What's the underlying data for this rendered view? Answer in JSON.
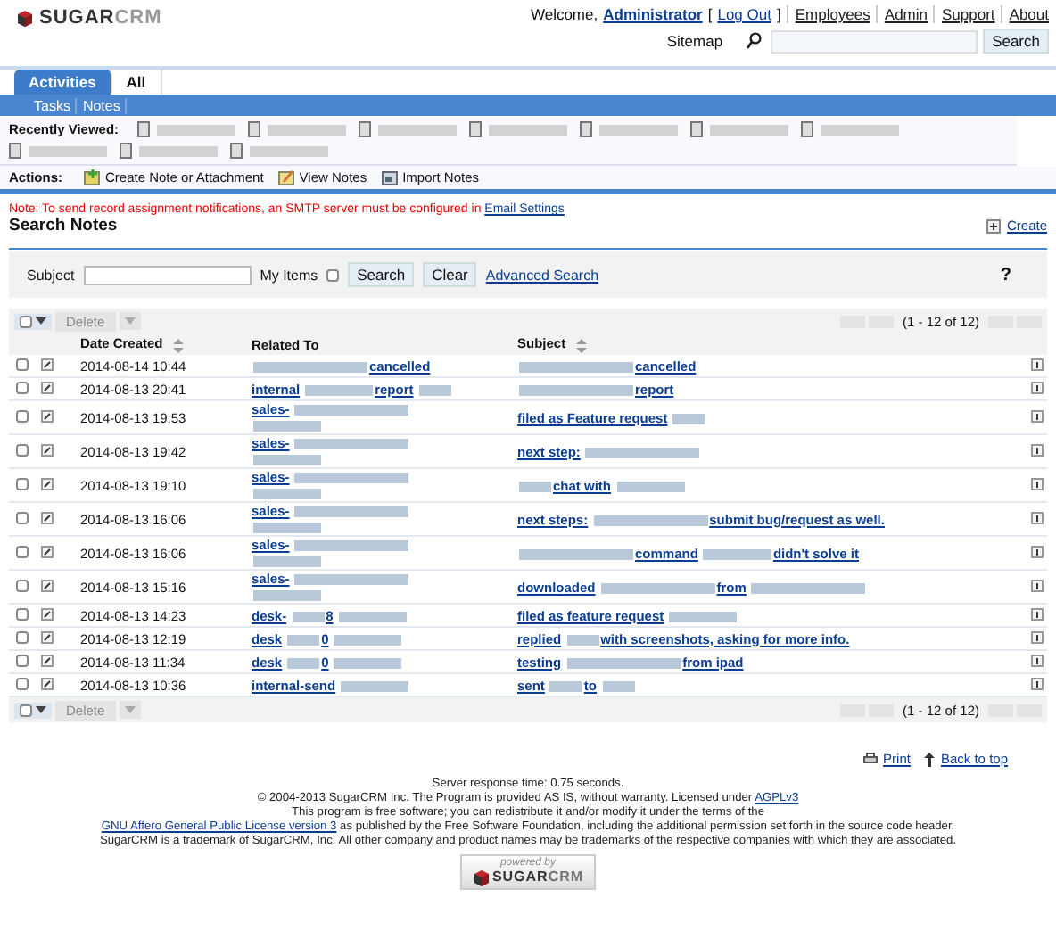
{
  "header": {
    "logo_main": "SUGAR",
    "logo_tail": "CRM",
    "welcome": "Welcome,",
    "user": "Administrator",
    "logout_open": "[",
    "logout": "Log Out",
    "logout_close": "]",
    "links": [
      "Employees",
      "Admin",
      "Support",
      "About"
    ],
    "sitemap": "Sitemap",
    "search_button": "Search"
  },
  "tabs": [
    {
      "label": "Activities",
      "selected": true
    },
    {
      "label": "All",
      "selected": false
    }
  ],
  "subtabs": [
    {
      "label": "Tasks"
    },
    {
      "label": "Notes"
    }
  ],
  "recently_viewed": {
    "label": "Recently Viewed:",
    "items": [
      {
        "kind": "blurred"
      },
      {
        "kind": "blurred"
      },
      {
        "kind": "blurred"
      },
      {
        "kind": "blurred"
      },
      {
        "kind": "blurred"
      },
      {
        "kind": "blurred"
      },
      {
        "kind": "blurred"
      },
      {
        "kind": "blurred"
      },
      {
        "kind": "blurred"
      },
      {
        "kind": "blurred"
      }
    ]
  },
  "actions": {
    "label": "Actions:",
    "items": [
      "Create Note or Attachment",
      "View Notes",
      "Import Notes"
    ]
  },
  "notice": {
    "text": "Note: To send record assignment notifications, an SMTP server must be configured in",
    "link": "Email Settings"
  },
  "title": "Search Notes",
  "create": "Create",
  "search": {
    "subject_label": "Subject",
    "my_items_label": "My Items",
    "my_items_checked": false,
    "search_button": "Search",
    "clear_button": "Clear",
    "advanced": "Advanced Search",
    "help": "?"
  },
  "pager_top": {
    "delete": "Delete",
    "range": "(1 - 12 of 12)"
  },
  "table": {
    "columns": [
      "Date Created",
      "Related To",
      "Subject"
    ],
    "rows": [
      {
        "selected": false,
        "date": "2014-08-14 10:44",
        "related": [
          {
            "kind": "blur_long"
          },
          {
            "kind": "text",
            "text": "cancelled"
          }
        ],
        "subject": [
          {
            "kind": "blur_long"
          },
          {
            "kind": "text",
            "text": "cancelled"
          }
        ]
      },
      {
        "selected": false,
        "date": "2014-08-13 20:41",
        "related": [
          {
            "kind": "text",
            "text": "internal"
          },
          {
            "kind": "blur"
          },
          {
            "kind": "text",
            "text": "report"
          },
          {
            "kind": "blur_short"
          }
        ],
        "subject": [
          {
            "kind": "blur_long"
          },
          {
            "kind": "text",
            "text": "report"
          }
        ]
      },
      {
        "selected": false,
        "date": "2014-08-13 19:53",
        "related": [
          {
            "kind": "text",
            "text": "sales-"
          },
          {
            "kind": "blur_long"
          },
          {
            "kind": "break"
          },
          {
            "kind": "blur"
          }
        ],
        "subject": [
          {
            "kind": "text",
            "text": "filed as Feature request"
          },
          {
            "kind": "blur_short"
          }
        ]
      },
      {
        "selected": false,
        "date": "2014-08-13 19:42",
        "related": [
          {
            "kind": "text",
            "text": "sales-"
          },
          {
            "kind": "blur_long"
          },
          {
            "kind": "break"
          },
          {
            "kind": "blur"
          }
        ],
        "subject": [
          {
            "kind": "text",
            "text": "next step:"
          },
          {
            "kind": "blur_long"
          }
        ]
      },
      {
        "selected": false,
        "date": "2014-08-13 19:10",
        "related": [
          {
            "kind": "text",
            "text": "sales-"
          },
          {
            "kind": "blur_long"
          },
          {
            "kind": "break"
          },
          {
            "kind": "blur"
          }
        ],
        "subject": [
          {
            "kind": "blur_short"
          },
          {
            "kind": "text",
            "text": "chat with"
          },
          {
            "kind": "blur"
          }
        ]
      },
      {
        "selected": false,
        "date": "2014-08-13 16:06",
        "related": [
          {
            "kind": "text",
            "text": "sales-"
          },
          {
            "kind": "blur_long"
          },
          {
            "kind": "break"
          },
          {
            "kind": "blur"
          }
        ],
        "subject": [
          {
            "kind": "text",
            "text": "next steps:"
          },
          {
            "kind": "blur_long"
          },
          {
            "kind": "text",
            "text": "submit bug/request as well."
          }
        ]
      },
      {
        "selected": false,
        "date": "2014-08-13 16:06",
        "related": [
          {
            "kind": "text",
            "text": "sales-"
          },
          {
            "kind": "blur_long"
          },
          {
            "kind": "break"
          },
          {
            "kind": "blur"
          }
        ],
        "subject": [
          {
            "kind": "blur_long"
          },
          {
            "kind": "text",
            "text": "command"
          },
          {
            "kind": "blur"
          },
          {
            "kind": "text",
            "text": "didn't solve it"
          }
        ]
      },
      {
        "selected": false,
        "date": "2014-08-13 15:16",
        "related": [
          {
            "kind": "text",
            "text": "sales-"
          },
          {
            "kind": "blur_long"
          },
          {
            "kind": "break"
          },
          {
            "kind": "blur"
          }
        ],
        "subject": [
          {
            "kind": "text",
            "text": "downloaded"
          },
          {
            "kind": "blur_long"
          },
          {
            "kind": "text",
            "text": "from"
          },
          {
            "kind": "blur_long"
          }
        ]
      },
      {
        "selected": false,
        "date": "2014-08-13 14:23",
        "related": [
          {
            "kind": "text",
            "text": "desk-"
          },
          {
            "kind": "blur_short"
          },
          {
            "kind": "text",
            "text": "8"
          },
          {
            "kind": "blur"
          }
        ],
        "subject": [
          {
            "kind": "text",
            "text": "filed as feature request"
          },
          {
            "kind": "blur"
          }
        ]
      },
      {
        "selected": false,
        "date": "2014-08-13 12:19",
        "related": [
          {
            "kind": "text",
            "text": "desk"
          },
          {
            "kind": "blur_short"
          },
          {
            "kind": "text",
            "text": "0"
          },
          {
            "kind": "blur"
          }
        ],
        "subject": [
          {
            "kind": "text",
            "text": "replied"
          },
          {
            "kind": "blur_short"
          },
          {
            "kind": "text",
            "text": "with screenshots, asking for more info."
          }
        ]
      },
      {
        "selected": false,
        "date": "2014-08-13 11:34",
        "related": [
          {
            "kind": "text",
            "text": "desk"
          },
          {
            "kind": "blur_short"
          },
          {
            "kind": "text",
            "text": "0"
          },
          {
            "kind": "blur"
          }
        ],
        "subject": [
          {
            "kind": "text",
            "text": "testing"
          },
          {
            "kind": "blur_long"
          },
          {
            "kind": "text",
            "text": "from ipad"
          }
        ]
      },
      {
        "selected": false,
        "date": "2014-08-13 10:36",
        "related": [
          {
            "kind": "text",
            "text": "internal-send"
          },
          {
            "kind": "blur"
          }
        ],
        "subject": [
          {
            "kind": "text",
            "text": "sent"
          },
          {
            "kind": "blur_short"
          },
          {
            "kind": "text",
            "text": "to"
          },
          {
            "kind": "blur_short"
          }
        ]
      }
    ]
  },
  "pager_bottom": {
    "delete": "Delete",
    "range": "(1 - 12 of 12)"
  },
  "print": "Print",
  "back_to_top": "Back to top",
  "footer": {
    "server_time": "Server response time: 0.75 seconds.",
    "copyright": "© 2004-2013 SugarCRM Inc. The Program is provided AS IS, without warranty. Licensed under",
    "license_link": "AGPLv3",
    "free_software": "This program is free software; you can redistribute it and/or modify it under the terms of the",
    "gnu_link": "GNU Affero General Public License version 3",
    "gnu_rest": "as published by the Free Software Foundation, including the additional permission set forth in the source code header.",
    "trademark": "SugarCRM is a trademark of SugarCRM, Inc. All other company and product names may be trademarks of the respective companies with which they are associated.",
    "powered_by": "powered by",
    "badge_main": "SUGAR",
    "badge_tail": "CRM"
  }
}
